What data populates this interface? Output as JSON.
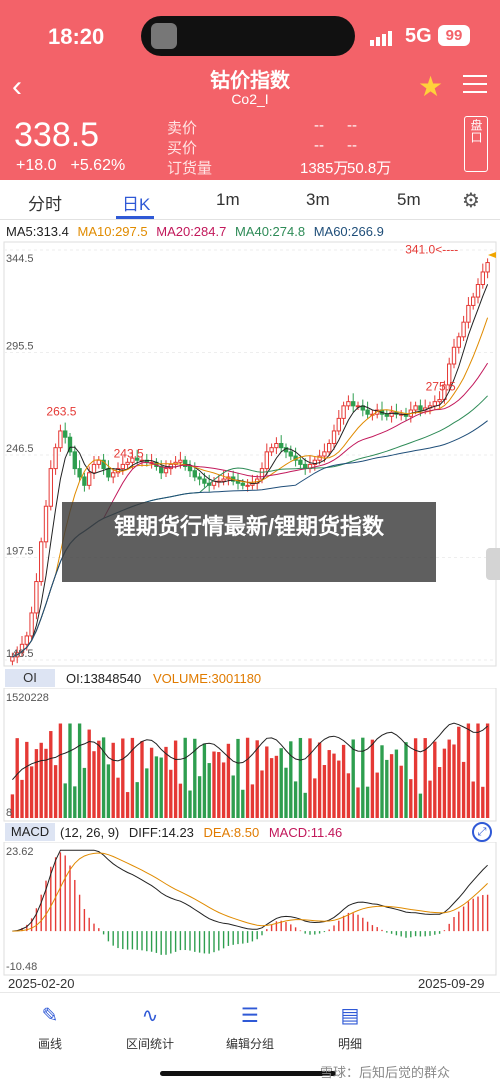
{
  "status": {
    "time": "18:20",
    "network": "5G",
    "battery": "99"
  },
  "header": {
    "title": "钴价指数",
    "subtitle": "Co2_I",
    "price": "338.5",
    "change": "+18.0",
    "change_pct": "+5.62%",
    "quote_labels": [
      "卖价",
      "买价",
      "订货量"
    ],
    "quote_col1": [
      "--",
      "--",
      "1385万"
    ],
    "quote_col2": [
      "--",
      "--",
      "50.8万"
    ],
    "pankou": "盘口"
  },
  "tabs": [
    "分时",
    "日K",
    "1m",
    "3m",
    "5m"
  ],
  "active_tab": "日K",
  "ma": {
    "ma5": "MA5:313.4",
    "ma10": "MA10:297.5",
    "ma20": "MA20:284.7",
    "ma40": "MA40:274.8",
    "ma60": "MA60:266.9",
    "colors": {
      "ma5": "#222222",
      "ma10": "#e08b00",
      "ma20": "#c2185b",
      "ma40": "#2e8b57",
      "ma60": "#1f4e79"
    }
  },
  "overlay_text": "锂期货行情最新/锂期货指数",
  "volume": {
    "tag": "OI",
    "oi": "OI:13848540",
    "volume": "VOLUME:3001180",
    "axis_top": "1520228",
    "axis_bottom": "8"
  },
  "macd": {
    "tag": "MACD",
    "params": "(12, 26, 9)",
    "diff": "DIFF:14.23",
    "dea": "DEA:8.50",
    "macd": "MACD:11.46",
    "axis_top": "23.62",
    "axis_bottom": "-10.48"
  },
  "dates": {
    "start": "2025-02-20",
    "end": "2025-09-29"
  },
  "bottom_nav": [
    "画线",
    "区间统计",
    "编辑分组",
    "明细"
  ],
  "watermark": "雪球：后知后觉的群众",
  "chart_data": {
    "type": "candlestick",
    "y_ticks": [
      "344.5",
      "295.5",
      "246.5",
      "197.5",
      "148.5"
    ],
    "ylim": [
      148.5,
      344.5
    ],
    "annotations": [
      "263.5",
      "243.5",
      "275.5",
      "341.0<----"
    ],
    "closes": [
      150,
      152,
      156,
      160,
      171,
      186,
      205,
      222,
      240,
      250,
      258,
      255,
      248,
      240,
      236,
      232,
      238,
      242,
      244,
      240,
      236,
      238,
      240,
      242,
      243,
      245,
      244,
      244,
      243,
      243,
      241,
      238,
      240,
      242,
      243,
      244,
      241,
      239,
      236,
      235,
      233,
      232,
      234,
      234,
      235,
      236,
      234,
      233,
      232,
      232,
      233,
      235,
      240,
      248,
      250,
      252,
      250,
      248,
      246,
      244,
      242,
      240,
      242,
      244,
      246,
      248,
      252,
      258,
      264,
      270,
      272,
      270,
      270,
      268,
      266,
      266,
      268,
      266,
      265,
      267,
      266,
      266,
      265,
      268,
      270,
      268,
      269,
      270,
      272,
      273,
      280,
      290,
      298,
      303,
      310,
      318,
      322,
      328,
      334,
      338.5
    ]
  }
}
